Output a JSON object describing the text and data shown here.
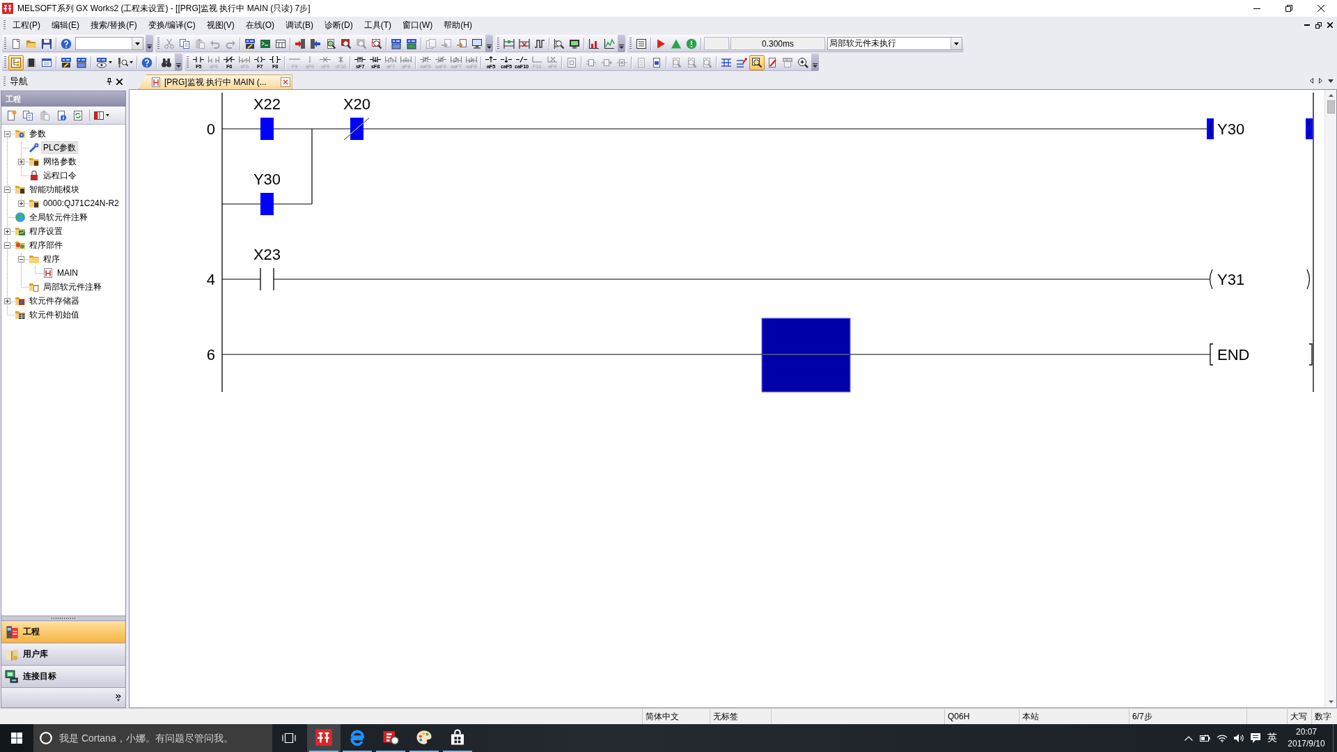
{
  "window": {
    "title": "MELSOFT系列 GX Works2 (工程未设置) - [[PRG]监视 执行中 MAIN (只读) 7步]"
  },
  "menu": [
    "工程(P)",
    "编辑(E)",
    "搜索/替换(F)",
    "变换/编译(C)",
    "视图(V)",
    "在线(O)",
    "调试(B)",
    "诊断(D)",
    "工具(T)",
    "窗口(W)",
    "帮助(H)"
  ],
  "toolbar_rows": [
    {
      "bands": [
        {
          "overflow": true,
          "items": [
            {
              "kind": "new",
              "disabled": false,
              "on": false
            },
            {
              "kind": "open",
              "disabled": false,
              "on": false
            },
            {
              "kind": "save",
              "disabled": false,
              "on": false
            },
            {
              "kind": "separator"
            },
            {
              "kind": "help",
              "disabled": false,
              "on": false
            },
            {
              "kind": "combo"
            }
          ]
        },
        {
          "overflow": true,
          "items": [
            {
              "kind": "cut",
              "disabled": true,
              "on": false
            },
            {
              "kind": "copy",
              "disabled": false,
              "on": false
            },
            {
              "kind": "paste",
              "disabled": true,
              "on": false
            },
            {
              "kind": "undo",
              "disabled": true,
              "on": false
            },
            {
              "kind": "redo",
              "disabled": true,
              "on": false
            },
            {
              "kind": "separator"
            },
            {
              "kind": "devpen",
              "disabled": false,
              "on": false
            },
            {
              "kind": "terminal",
              "disabled": false,
              "on": false
            },
            {
              "kind": "grid",
              "disabled": false,
              "on": false
            },
            {
              "kind": "separator"
            },
            {
              "kind": "readin",
              "disabled": false,
              "on": false
            },
            {
              "kind": "writeout",
              "disabled": false,
              "on": false
            },
            {
              "kind": "verify",
              "disabled": false,
              "on": false
            },
            {
              "kind": "searchred",
              "disabled": false,
              "on": false
            },
            {
              "kind": "searchgray",
              "disabled": true,
              "on": false
            },
            {
              "kind": "searchgrid",
              "disabled": false,
              "on": false
            },
            {
              "kind": "separator"
            },
            {
              "kind": "devread",
              "disabled": false,
              "on": false
            },
            {
              "kind": "devchip",
              "disabled": false,
              "on": false
            },
            {
              "kind": "separator"
            },
            {
              "kind": "pages",
              "disabled": true,
              "on": false
            },
            {
              "kind": "pagesarrow",
              "disabled": true,
              "on": false
            },
            {
              "kind": "pagesorange",
              "disabled": false,
              "on": false
            },
            {
              "kind": "pc",
              "disabled": false,
              "on": false
            }
          ]
        },
        {
          "overflow": true,
          "items": [
            {
              "kind": "ladgreen",
              "disabled": false,
              "on": false
            },
            {
              "kind": "ladred",
              "disabled": false,
              "on": false
            },
            {
              "kind": "pulse",
              "disabled": false,
              "on": false
            },
            {
              "kind": "separator"
            },
            {
              "kind": "zoomlad",
              "disabled": false,
              "on": false
            },
            {
              "kind": "monitor",
              "disabled": false,
              "on": false
            },
            {
              "kind": "separator"
            },
            {
              "kind": "chartred",
              "disabled": false,
              "on": false
            },
            {
              "kind": "chartgreen",
              "disabled": false,
              "on": false
            }
          ]
        },
        {
          "overflow": false,
          "items": [
            {
              "kind": "gridbox",
              "disabled": false,
              "on": false
            },
            {
              "kind": "separator"
            },
            {
              "kind": "run",
              "disabled": false,
              "on": false
            },
            {
              "kind": "triup",
              "disabled": false,
              "on": false
            },
            {
              "kind": "alert",
              "disabled": false,
              "on": false
            },
            {
              "kind": "separator"
            },
            {
              "kind": "field"
            },
            {
              "kind": "readout",
              "text": "0.300ms"
            },
            {
              "kind": "combo",
              "value": "局部软元件未执行"
            }
          ]
        }
      ]
    },
    {
      "bands": [
        {
          "overflow": true,
          "items": [
            {
              "kind": "tree",
              "disabled": false,
              "on": true
            },
            {
              "kind": "chip",
              "disabled": false,
              "on": false
            },
            {
              "kind": "window",
              "disabled": false,
              "on": false
            },
            {
              "kind": "separator"
            },
            {
              "kind": "devpen",
              "disabled": false,
              "on": false
            },
            {
              "kind": "devread",
              "disabled": false,
              "on": false
            },
            {
              "kind": "separator"
            },
            {
              "kind": "deveye",
              "disabled": false,
              "on": false
            },
            {
              "kind": "probe",
              "disabled": false,
              "on": false
            },
            {
              "kind": "separator"
            },
            {
              "kind": "help",
              "disabled": false,
              "on": false
            },
            {
              "kind": "separator"
            },
            {
              "kind": "binoculars",
              "disabled": false,
              "on": false
            }
          ]
        },
        {
          "overflow": true,
          "items": [
            {
              "kind": "contact",
              "key": "F5",
              "disabled": false,
              "on": false
            },
            {
              "kind": "pcontact",
              "key": "sF5",
              "disabled": true,
              "on": false
            },
            {
              "kind": "nccontact",
              "key": "F6",
              "disabled": false,
              "on": false
            },
            {
              "kind": "pnccontact",
              "key": "sF6",
              "disabled": true,
              "on": false
            },
            {
              "kind": "coil",
              "key": "F7",
              "disabled": false,
              "on": false
            },
            {
              "kind": "instr",
              "key": "F8",
              "disabled": false,
              "on": false
            },
            {
              "kind": "separator"
            },
            {
              "kind": "hline",
              "key": "F9",
              "disabled": true,
              "on": false
            },
            {
              "kind": "vline",
              "key": "sF9",
              "disabled": true,
              "on": false
            },
            {
              "kind": "delh",
              "key": "cF9",
              "disabled": true,
              "on": false
            },
            {
              "kind": "delv",
              "key": "cF10",
              "disabled": true,
              "on": false
            },
            {
              "kind": "separator"
            },
            {
              "kind": "rise",
              "key": "sF7",
              "disabled": false,
              "on": false
            },
            {
              "kind": "fall",
              "key": "sF8",
              "disabled": false,
              "on": false
            },
            {
              "kind": "prise",
              "key": "aF7",
              "disabled": true,
              "on": false
            },
            {
              "kind": "pfall",
              "key": "aF8",
              "disabled": true,
              "on": false
            },
            {
              "kind": "separator"
            },
            {
              "kind": "ncrise",
              "key": "saF5",
              "disabled": true,
              "on": false
            },
            {
              "kind": "ncfall",
              "key": "saF6",
              "disabled": true,
              "on": false
            },
            {
              "kind": "pncrise",
              "key": "saF7",
              "disabled": true,
              "on": false
            },
            {
              "kind": "pncfall",
              "key": "saF8",
              "disabled": true,
              "on": false
            },
            {
              "kind": "separator"
            },
            {
              "kind": "upar",
              "key": "aF5",
              "disabled": false,
              "on": false
            },
            {
              "kind": "downar",
              "key": "caF5",
              "disabled": false,
              "on": false
            },
            {
              "kind": "invert",
              "key": "caF10",
              "disabled": false,
              "on": false
            },
            {
              "kind": "linedraw",
              "key": "F10",
              "disabled": true,
              "on": false
            },
            {
              "kind": "linedel",
              "key": "aF9",
              "disabled": true,
              "on": false
            },
            {
              "kind": "separator"
            },
            {
              "kind": "stbox",
              "disabled": true,
              "on": false
            },
            {
              "kind": "separator"
            },
            {
              "kind": "fbda",
              "disabled": true,
              "on": false
            },
            {
              "kind": "fbdb",
              "disabled": true,
              "on": false
            },
            {
              "kind": "fbdc",
              "disabled": true,
              "on": false
            },
            {
              "kind": "separator"
            },
            {
              "kind": "pagelines",
              "disabled": true,
              "on": false
            },
            {
              "kind": "pagebox",
              "disabled": false,
              "on": false
            },
            {
              "kind": "separator"
            },
            {
              "kind": "pagemag",
              "disabled": true,
              "on": false
            },
            {
              "kind": "pagemag",
              "disabled": true,
              "on": false
            },
            {
              "kind": "pagemag",
              "disabled": true,
              "on": false
            },
            {
              "kind": "separator"
            },
            {
              "kind": "rungs",
              "disabled": false,
              "on": false
            },
            {
              "kind": "rungpin",
              "disabled": false,
              "on": false
            },
            {
              "kind": "monzoom",
              "disabled": false,
              "on": true
            },
            {
              "kind": "penedit",
              "disabled": false,
              "on": false
            },
            {
              "kind": "tagpage",
              "disabled": true,
              "on": false
            },
            {
              "kind": "zoomin",
              "disabled": false,
              "on": false
            }
          ]
        }
      ]
    }
  ],
  "navigation": {
    "title": "导航",
    "section": "工程",
    "tools": [
      {
        "kind": "newitem",
        "disabled": false
      },
      {
        "kind": "copy",
        "disabled": false
      },
      {
        "kind": "paste",
        "disabled": true
      },
      {
        "kind": "properties",
        "disabled": false
      },
      {
        "kind": "refresh",
        "disabled": false
      },
      {
        "kind": "separator"
      },
      {
        "kind": "dock",
        "disabled": false
      }
    ],
    "tree": [
      {
        "label": "参数",
        "kind": "params",
        "expanded": true,
        "selected": false,
        "children": [
          {
            "label": "PLC参数",
            "kind": "plc",
            "selected": true
          },
          {
            "label": "网络参数",
            "kind": "network",
            "expanded": false,
            "selected": false
          },
          {
            "label": "远程口令",
            "kind": "lock",
            "selected": false
          }
        ]
      },
      {
        "label": "智能功能模块",
        "kind": "module",
        "expanded": true,
        "selected": false,
        "children": [
          {
            "label": "0000:QJ71C24N-R2",
            "kind": "module",
            "expanded": false,
            "selected": false
          }
        ]
      },
      {
        "label": "全局软元件注释",
        "kind": "globe",
        "selected": false
      },
      {
        "label": "程序设置",
        "kind": "settings",
        "expanded": false,
        "selected": false
      },
      {
        "label": "程序部件",
        "kind": "parts",
        "expanded": true,
        "selected": false,
        "children": [
          {
            "label": "程序",
            "kind": "folder",
            "expanded": true,
            "selected": false,
            "children": [
              {
                "label": "MAIN",
                "kind": "program",
                "selected": false
              }
            ]
          },
          {
            "label": "局部软元件注释",
            "kind": "comments",
            "selected": false
          }
        ]
      },
      {
        "label": "软元件存储器",
        "kind": "memory",
        "expanded": false,
        "selected": false
      },
      {
        "label": "软元件初始值",
        "kind": "init",
        "selected": false
      }
    ],
    "views": [
      {
        "label": "工程",
        "kind": "project",
        "selected": true
      },
      {
        "label": "用户库",
        "kind": "library",
        "selected": false
      },
      {
        "label": "连接目标",
        "kind": "connection",
        "selected": false
      }
    ]
  },
  "tabs": [
    {
      "label": "[PRG]监视 执行中 MAIN (...",
      "selected": true
    }
  ],
  "ladder": {
    "rungs": [
      {
        "step": "0",
        "selected": false,
        "elements": [
          {
            "kind": "parallel",
            "branches": [
              [
                {
                  "kind": "contact",
                  "device": "X22",
                  "on": true
                }
              ],
              [
                {
                  "kind": "contact",
                  "device": "Y30",
                  "on": true
                }
              ]
            ]
          },
          {
            "kind": "nccontact",
            "device": "X20",
            "on": true
          }
        ],
        "output": {
          "kind": "coil",
          "device": "Y30",
          "on": true
        }
      },
      {
        "step": "4",
        "selected": false,
        "elements": [
          {
            "kind": "contact",
            "device": "X23",
            "on": false
          }
        ],
        "output": {
          "kind": "coil",
          "device": "Y31",
          "on": false
        }
      },
      {
        "step": "6",
        "selected": true,
        "output": {
          "kind": "end",
          "instruction": "END"
        }
      }
    ]
  },
  "status_bar": [
    "简体中文",
    "无标签",
    "Q06H",
    "本站",
    "6/7步",
    "大写",
    "数字"
  ],
  "taskbar": {
    "search": {
      "placeholder": "我是 Cortana，小娜。有问题尽管问我。"
    },
    "apps": [
      {
        "kind": "gxworks",
        "selected": true,
        "running": true
      },
      {
        "kind": "browser",
        "selected": false,
        "running": true
      },
      {
        "kind": "gtool",
        "selected": false,
        "running": true
      },
      {
        "kind": "paint",
        "selected": false,
        "running": true
      },
      {
        "kind": "store",
        "selected": false,
        "running": true
      }
    ],
    "tray": {
      "input_mode": "英",
      "time": "20:07",
      "date": "2017/9/10"
    }
  }
}
